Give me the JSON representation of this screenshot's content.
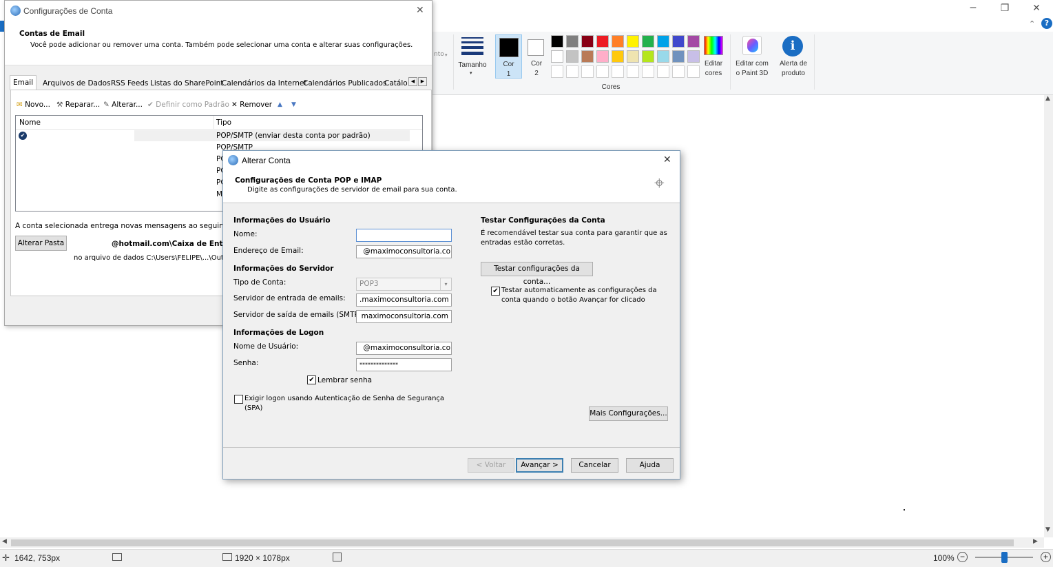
{
  "paint": {
    "ribbon": {
      "tamanho_label": "Tamanho",
      "partial_label": "nto",
      "cor1_label": "Cor\n1",
      "cor1_line1": "Cor",
      "cor1_line2": "1",
      "cor2_line1": "Cor",
      "cor2_line2": "2",
      "cores_group_label": "Cores",
      "editar_cores_line1": "Editar",
      "editar_cores_line2": "cores",
      "paint3d_line1": "Editar com",
      "paint3d_line2": "o Paint 3D",
      "alerta_line1": "Alerta de",
      "alerta_line2": "produto",
      "cor1_color": "#000000",
      "cor2_color": "#ffffff",
      "palette_row1": [
        "#000000",
        "#7f7f7f",
        "#880015",
        "#ed1c24",
        "#ff7f27",
        "#fff200",
        "#22b14c",
        "#00a2e8",
        "#3f48cc",
        "#a349a4"
      ],
      "palette_row2": [
        "#ffffff",
        "#c3c3c3",
        "#b97a57",
        "#ffaec9",
        "#ffc90e",
        "#efe4b0",
        "#b5e61d",
        "#99d9ea",
        "#7092be",
        "#c8bfe7"
      ]
    },
    "status": {
      "cursor_pos": "1642, 753px",
      "image_size": "1920 × 1078px",
      "zoom": "100%"
    }
  },
  "account_settings": {
    "title": "Configurações de Conta",
    "header_title": "Contas de Email",
    "header_desc": "Você pode adicionar ou remover uma conta. Também pode selecionar uma conta e alterar suas configurações.",
    "tabs": [
      "Email",
      "Arquivos de Dados",
      "RSS Feeds",
      "Listas do SharePoint",
      "Calendários da Internet",
      "Calendários Publicados",
      "Catálo"
    ],
    "toolbar": {
      "novo": "Novo...",
      "reparar": "Reparar...",
      "alterar": "Alterar...",
      "definir_padrao": "Definir como Padrão",
      "remover": "Remover"
    },
    "columns": {
      "name": "Nome",
      "type": "Tipo"
    },
    "rows": [
      {
        "type": "POP/SMTP (enviar desta conta por padrão)"
      },
      {
        "type": "POP/SMTP"
      },
      {
        "type": "PC"
      },
      {
        "type": "PC"
      },
      {
        "type": "PC"
      },
      {
        "type": "M"
      }
    ],
    "delivery_text": "A conta selecionada entrega novas mensagens ao seguinte local",
    "change_folder_button": "Alterar Pasta",
    "folder_path": "@hotmail.com\\Caixa de Entrada",
    "data_file_text": "no arquivo de dados C:\\Users\\FELIPE\\...\\Outlo"
  },
  "change_account": {
    "title": "Alterar Conta",
    "header_title": "Configurações de Conta POP e IMAP",
    "header_desc": "Digite as configurações de servidor de email para sua conta.",
    "user_info_heading": "Informações do Usuário",
    "name_label": "Nome:",
    "name_value": "",
    "email_label": "Endereço de Email:",
    "email_value": "@maximoconsultoria.co",
    "server_info_heading": "Informações do Servidor",
    "account_type_label": "Tipo de Conta:",
    "account_type_value": "POP3",
    "incoming_label": "Servidor de entrada de emails:",
    "incoming_value": ".maximoconsultoria.com",
    "outgoing_label": "Servidor de saída de emails (SMTP):",
    "outgoing_value": "maximoconsultoria.com",
    "logon_heading": "Informações de Logon",
    "username_label": "Nome de Usuário:",
    "username_value": "@maximoconsultoria.co",
    "password_label": "Senha:",
    "password_value": "**************",
    "remember_password": "Lembrar senha",
    "spa_label": "Exigir logon usando Autenticação de Senha de Segurança (SPA)",
    "spa_line1": "Exigir logon usando Autenticação de Senha de Segurança",
    "spa_line2": "(SPA)",
    "test_heading": "Testar Configurações da Conta",
    "test_desc_line1": "É recomendável testar sua conta para garantir que as",
    "test_desc_line2": "entradas estão corretas.",
    "test_button": "Testar configurações da conta...",
    "auto_test_line1": "Testar automaticamente as configurações da",
    "auto_test_line2": "conta quando o botão Avançar for clicado",
    "more_settings_button": "Mais Configurações...",
    "back_button": "< Voltar",
    "next_button": "Avançar >",
    "cancel_button": "Cancelar",
    "help_button": "Ajuda"
  }
}
